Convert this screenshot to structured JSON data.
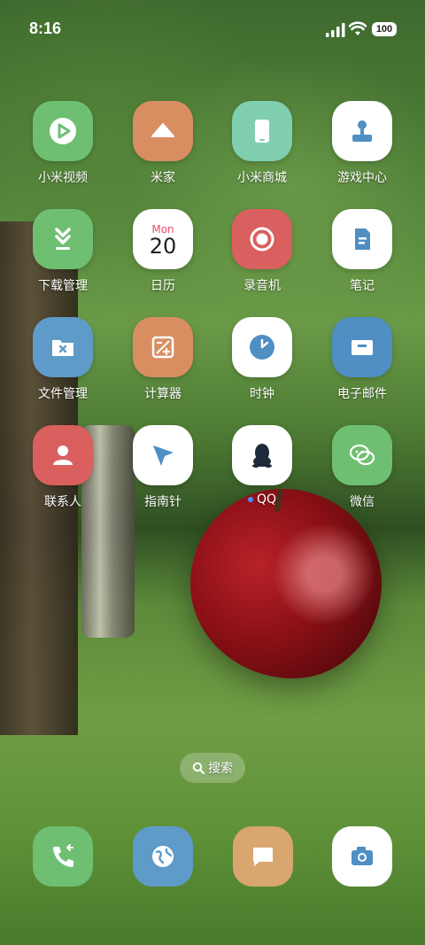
{
  "status_bar": {
    "time": "8:16",
    "battery": "100"
  },
  "apps": [
    {
      "label": "小米视频",
      "icon": "play-icon",
      "color": "#6fbf73"
    },
    {
      "label": "米家",
      "icon": "home-icon",
      "color": "#d98e62"
    },
    {
      "label": "小米商城",
      "icon": "phone-icon",
      "color": "#7fcfb0"
    },
    {
      "label": "游戏中心",
      "icon": "joystick-icon",
      "color": "#ffffff"
    },
    {
      "label": "下载管理",
      "icon": "download-icon",
      "color": "#6fbf73"
    },
    {
      "label": "日历",
      "icon": "calendar-icon",
      "color": "#ffffff",
      "month": "Mon",
      "day": "20"
    },
    {
      "label": "录音机",
      "icon": "record-icon",
      "color": "#d9605f"
    },
    {
      "label": "笔记",
      "icon": "note-icon",
      "color": "#ffffff"
    },
    {
      "label": "文件管理",
      "icon": "folder-icon",
      "color": "#5f9bc9"
    },
    {
      "label": "计算器",
      "icon": "calculator-icon",
      "color": "#d98e62"
    },
    {
      "label": "时钟",
      "icon": "clock-icon",
      "color": "#ffffff"
    },
    {
      "label": "电子邮件",
      "icon": "mail-icon",
      "color": "#4f8fc4"
    },
    {
      "label": "联系人",
      "icon": "contact-icon",
      "color": "#d9605f"
    },
    {
      "label": "指南针",
      "icon": "compass-icon",
      "color": "#ffffff"
    },
    {
      "label": "QQ",
      "icon": "qq-icon",
      "color": "#ffffff"
    },
    {
      "label": "微信",
      "icon": "wechat-icon",
      "color": "#6fbf73"
    }
  ],
  "search": {
    "label": "搜索"
  },
  "dock": [
    {
      "icon": "phone-call-icon",
      "color": "#6fbf73"
    },
    {
      "icon": "browser-icon",
      "color": "#5f9bc9"
    },
    {
      "icon": "messages-icon",
      "color": "#d9a66f"
    },
    {
      "icon": "camera-icon",
      "color": "#ffffff"
    }
  ]
}
